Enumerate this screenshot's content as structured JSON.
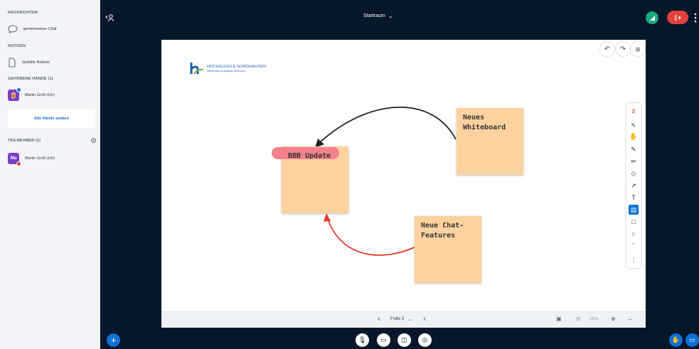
{
  "sidebar": {
    "messages_header": "NACHRICHTEN",
    "public_chat": "gemeinsamer Chat",
    "notes_header": "NOTIZEN",
    "shared_notes": "Geteilte Notizen",
    "raised_hands_header": "GEHOBENE HÄNDE (1)",
    "raised_hand_user": "Martin Groß (Ich)",
    "lower_all_hands": "Alle Hände senken",
    "participants_header": "TEILNEHMER (1)",
    "participant_initials": "Ma",
    "participant_name": "Martin Groß (Ich)"
  },
  "topbar": {
    "room_name": "Startraum",
    "room_chevron": "⌄"
  },
  "whiteboard": {
    "logo_title": "HOCHSCHULE NORDHAUSEN",
    "logo_subtitle": "University of Applied Sciences",
    "notes": {
      "update": "BBB Update",
      "whiteboard_line1": "Neues",
      "whiteboard_line2": "Whiteboard",
      "chat_line1": "Neue Chat-",
      "chat_line2": "Features"
    },
    "slide_label": "Folie 2",
    "zoom": "100%"
  },
  "colors": {
    "dark_bg": "#06172a",
    "accent_blue": "#0f70d7",
    "leave_red": "#e0413d",
    "connection_green": "#15a87a",
    "note_fill": "#fdd29f",
    "arrow_red": "#e33a2c"
  },
  "icons": [
    "chat-bubble-icon",
    "document-icon",
    "hand-icon",
    "settings-gear-icon",
    "users-icon",
    "undo-icon",
    "redo-icon",
    "grid-icon",
    "pointer-icon",
    "hand-pan-icon",
    "pen-icon",
    "marker-icon",
    "eraser-icon",
    "arrow-icon",
    "text-icon",
    "sticky-note-icon",
    "rectangle-icon",
    "ellipse-icon",
    "caret-up-icon",
    "more-icon",
    "plus-icon",
    "microphone-icon",
    "camera-icon",
    "screen-share-icon",
    "presentation-icon"
  ]
}
